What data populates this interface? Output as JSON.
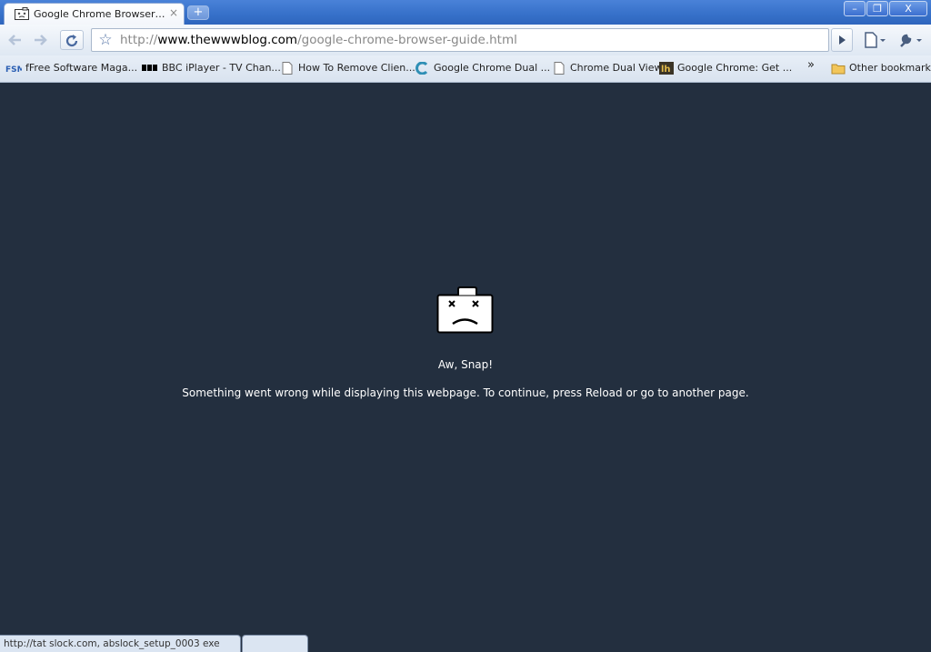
{
  "tab": {
    "title": "Google Chrome Browser Gu...",
    "close": "×",
    "new_tab": "+"
  },
  "window_controls": {
    "minimize": "–",
    "restore": "❐",
    "close": "X"
  },
  "omnibox": {
    "scheme": "http://",
    "host": "www.thewwwblog.com",
    "path": "/google-chrome-browser-guide.html"
  },
  "bookmarks": {
    "items": [
      {
        "label": "fFree Software Maga...",
        "icon": "fsm-icon"
      },
      {
        "label": "BBC iPlayer - TV Chan...",
        "icon": "bbc-icon"
      },
      {
        "label": "How To Remove Clien...",
        "icon": "page-icon"
      },
      {
        "label": "Google Chrome Dual ...",
        "icon": "c-logo-icon"
      },
      {
        "label": "Chrome Dual View",
        "icon": "page-icon"
      },
      {
        "label": "Google Chrome: Get ...",
        "icon": "lh-icon"
      }
    ],
    "overflow": "»",
    "other": "Other bookmarks"
  },
  "crash": {
    "title": "Aw, Snap!",
    "message": "Something went wrong while displaying this webpage. To continue, press Reload or go to another page."
  },
  "status": {
    "text": "http://tat slock.com,  abslock_setup_0003 exe"
  },
  "colors": {
    "crash_background": "#232f3f",
    "titlebar": "#3670c9"
  }
}
